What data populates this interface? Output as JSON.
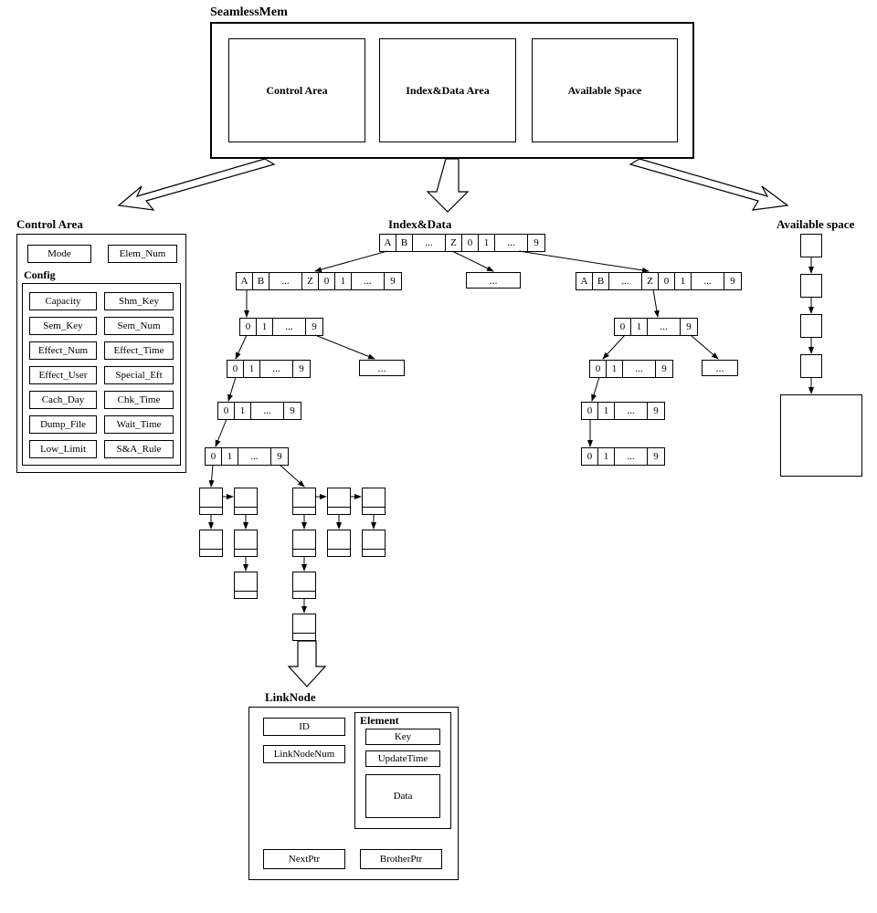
{
  "main_title": "SeamlessMem",
  "top_boxes": [
    "Control Area",
    "Index&Data Area",
    "Available Space"
  ],
  "section_titles": {
    "control": "Control Area",
    "indexdata": "Index&Data",
    "available": "Available space",
    "linknode": "LinkNode"
  },
  "control": {
    "mode": "Mode",
    "elem_num": "Elem_Num",
    "config_label": "Config",
    "config_rows": [
      [
        "Capacity",
        "Shm_Key"
      ],
      [
        "Sem_Key",
        "Sem_Num"
      ],
      [
        "Effect_Num",
        "Effect_Time"
      ],
      [
        "Effect_User",
        "Special_Eft"
      ],
      [
        "Cach_Day",
        "Chk_Time"
      ],
      [
        "Dump_File",
        "Wait_Time"
      ],
      [
        "Low_Limit",
        "S&A_Rule"
      ]
    ]
  },
  "alpha_cells": [
    "A",
    "B",
    "...",
    "Z",
    "0",
    "1",
    "...",
    "9"
  ],
  "num_cells": [
    "0",
    "1",
    "...",
    "9"
  ],
  "ellipsis": "...",
  "linknode": {
    "id": "ID",
    "linknodenum": "LinkNodeNum",
    "element_label": "Element",
    "key": "Key",
    "updatetime": "UpdateTime",
    "data": "Data",
    "nextptr": "NextPtr",
    "brotherptr": "BrotherPtr"
  }
}
